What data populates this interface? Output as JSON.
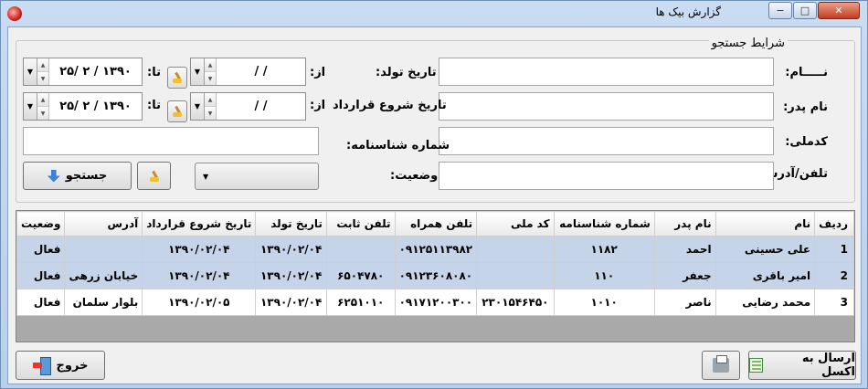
{
  "window": {
    "title": "گزارش بیک ها",
    "buttons": {
      "minimize": "−",
      "maximize": "□",
      "close": "✕"
    }
  },
  "search": {
    "group_title": "شرایط جستجو",
    "labels": {
      "name": "نـــــام:",
      "father_name": "نام پدر:",
      "national_code": "کدملی:",
      "phone_address": "تلفن/آدرس:",
      "birth_date": "تاریخ تولد:",
      "contract_start": "تاریخ شروع قرارداد",
      "id_number": "شماره شناسنامه:",
      "status": "وضعیت:",
      "from": "از:",
      "to": "تا:"
    },
    "birth_from": "/ /",
    "birth_to": "۱۳۹۰ / ۲ /۲۵",
    "contract_from": "/ /",
    "contract_to": "۱۳۹۰ / ۲ /۲۵",
    "search_button": "جستجو"
  },
  "table": {
    "columns": [
      "ردیف",
      "نام",
      "نام پدر",
      "شماره شناسنامه",
      "کد ملی",
      "تلفن همراه",
      "تلفن ثابت",
      "تاریخ تولد",
      "تاریخ شروع قرارداد",
      "آدرس",
      "وضعیت"
    ],
    "rows": [
      [
        "1",
        "علی حسینی",
        "احمد",
        "۱۱۸۲",
        "",
        "۰۹۱۲۵۱۱۳۹۸۲",
        "",
        "۱۳۹۰/۰۲/۰۴",
        "۱۳۹۰/۰۲/۰۴",
        "",
        "فعال"
      ],
      [
        "2",
        "امیر باقری",
        "جعفر",
        "۱۱۰",
        "",
        "۰۹۱۲۳۶۰۸۰۸۰",
        "۶۵۰۴۷۸۰",
        "۱۳۹۰/۰۲/۰۴",
        "۱۳۹۰/۰۲/۰۴",
        "خیابان زرهی",
        "فعال"
      ],
      [
        "3",
        "محمد رضایی",
        "ناصر",
        "۱۰۱۰",
        "۲۳۰۱۵۴۶۴۵۰",
        "۰۹۱۷۱۲۰۰۳۰۰",
        "۶۲۵۱۰۱۰",
        "۱۳۹۰/۰۲/۰۴",
        "۱۳۹۰/۰۲/۰۵",
        "بلوار سلمان",
        "فعال"
      ]
    ]
  },
  "footer": {
    "export_excel": "ارسال به اکسل",
    "exit": "خروج"
  },
  "icons": [
    "app-icon",
    "broom-icon",
    "arrow-down-icon",
    "excel-icon",
    "print-icon",
    "exit-door-icon"
  ]
}
